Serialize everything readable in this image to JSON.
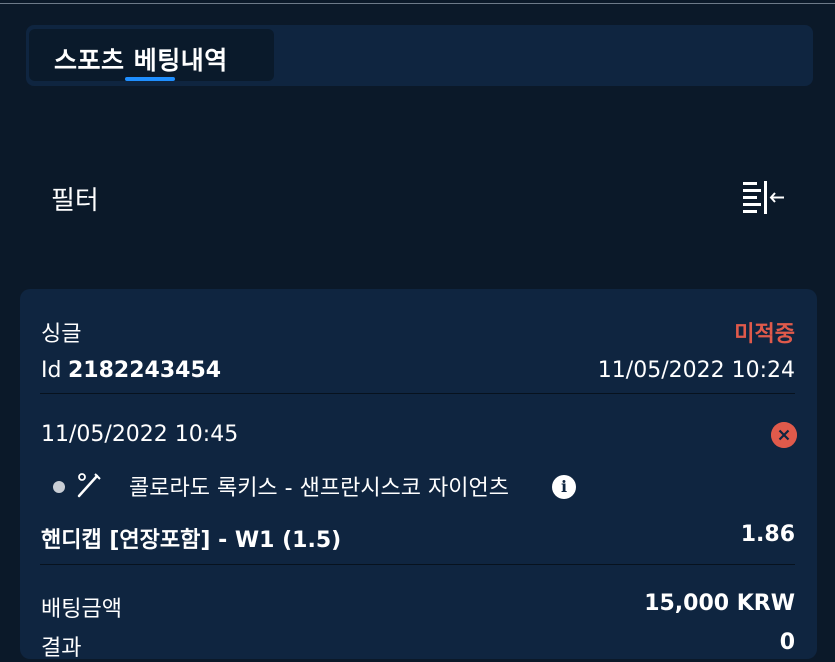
{
  "header": {
    "tab_label": "스포츠 베팅내역"
  },
  "filter": {
    "label": "필터",
    "icon": "collapse-filter-icon"
  },
  "bet": {
    "type": "싱글",
    "status": "미적중",
    "id_prefix": "Id",
    "id_value": "2182243454",
    "placed_at": "11/05/2022 10:24",
    "event_time": "11/05/2022 10:45",
    "sport_icon": "baseball-bat-icon",
    "match": "콜로라도 록키스 - 샌프란시스코 자이언츠",
    "market": "핸디캡 [연장포함] - W1 (1.5)",
    "odds": "1.86",
    "stake_label": "배팅금액",
    "stake_value": "15,000 KRW",
    "result_label": "결과",
    "result_value": "0"
  },
  "colors": {
    "background": "#0b1929",
    "card": "#0f2540",
    "accent": "#1f8fff",
    "lost": "#e05a4b"
  }
}
